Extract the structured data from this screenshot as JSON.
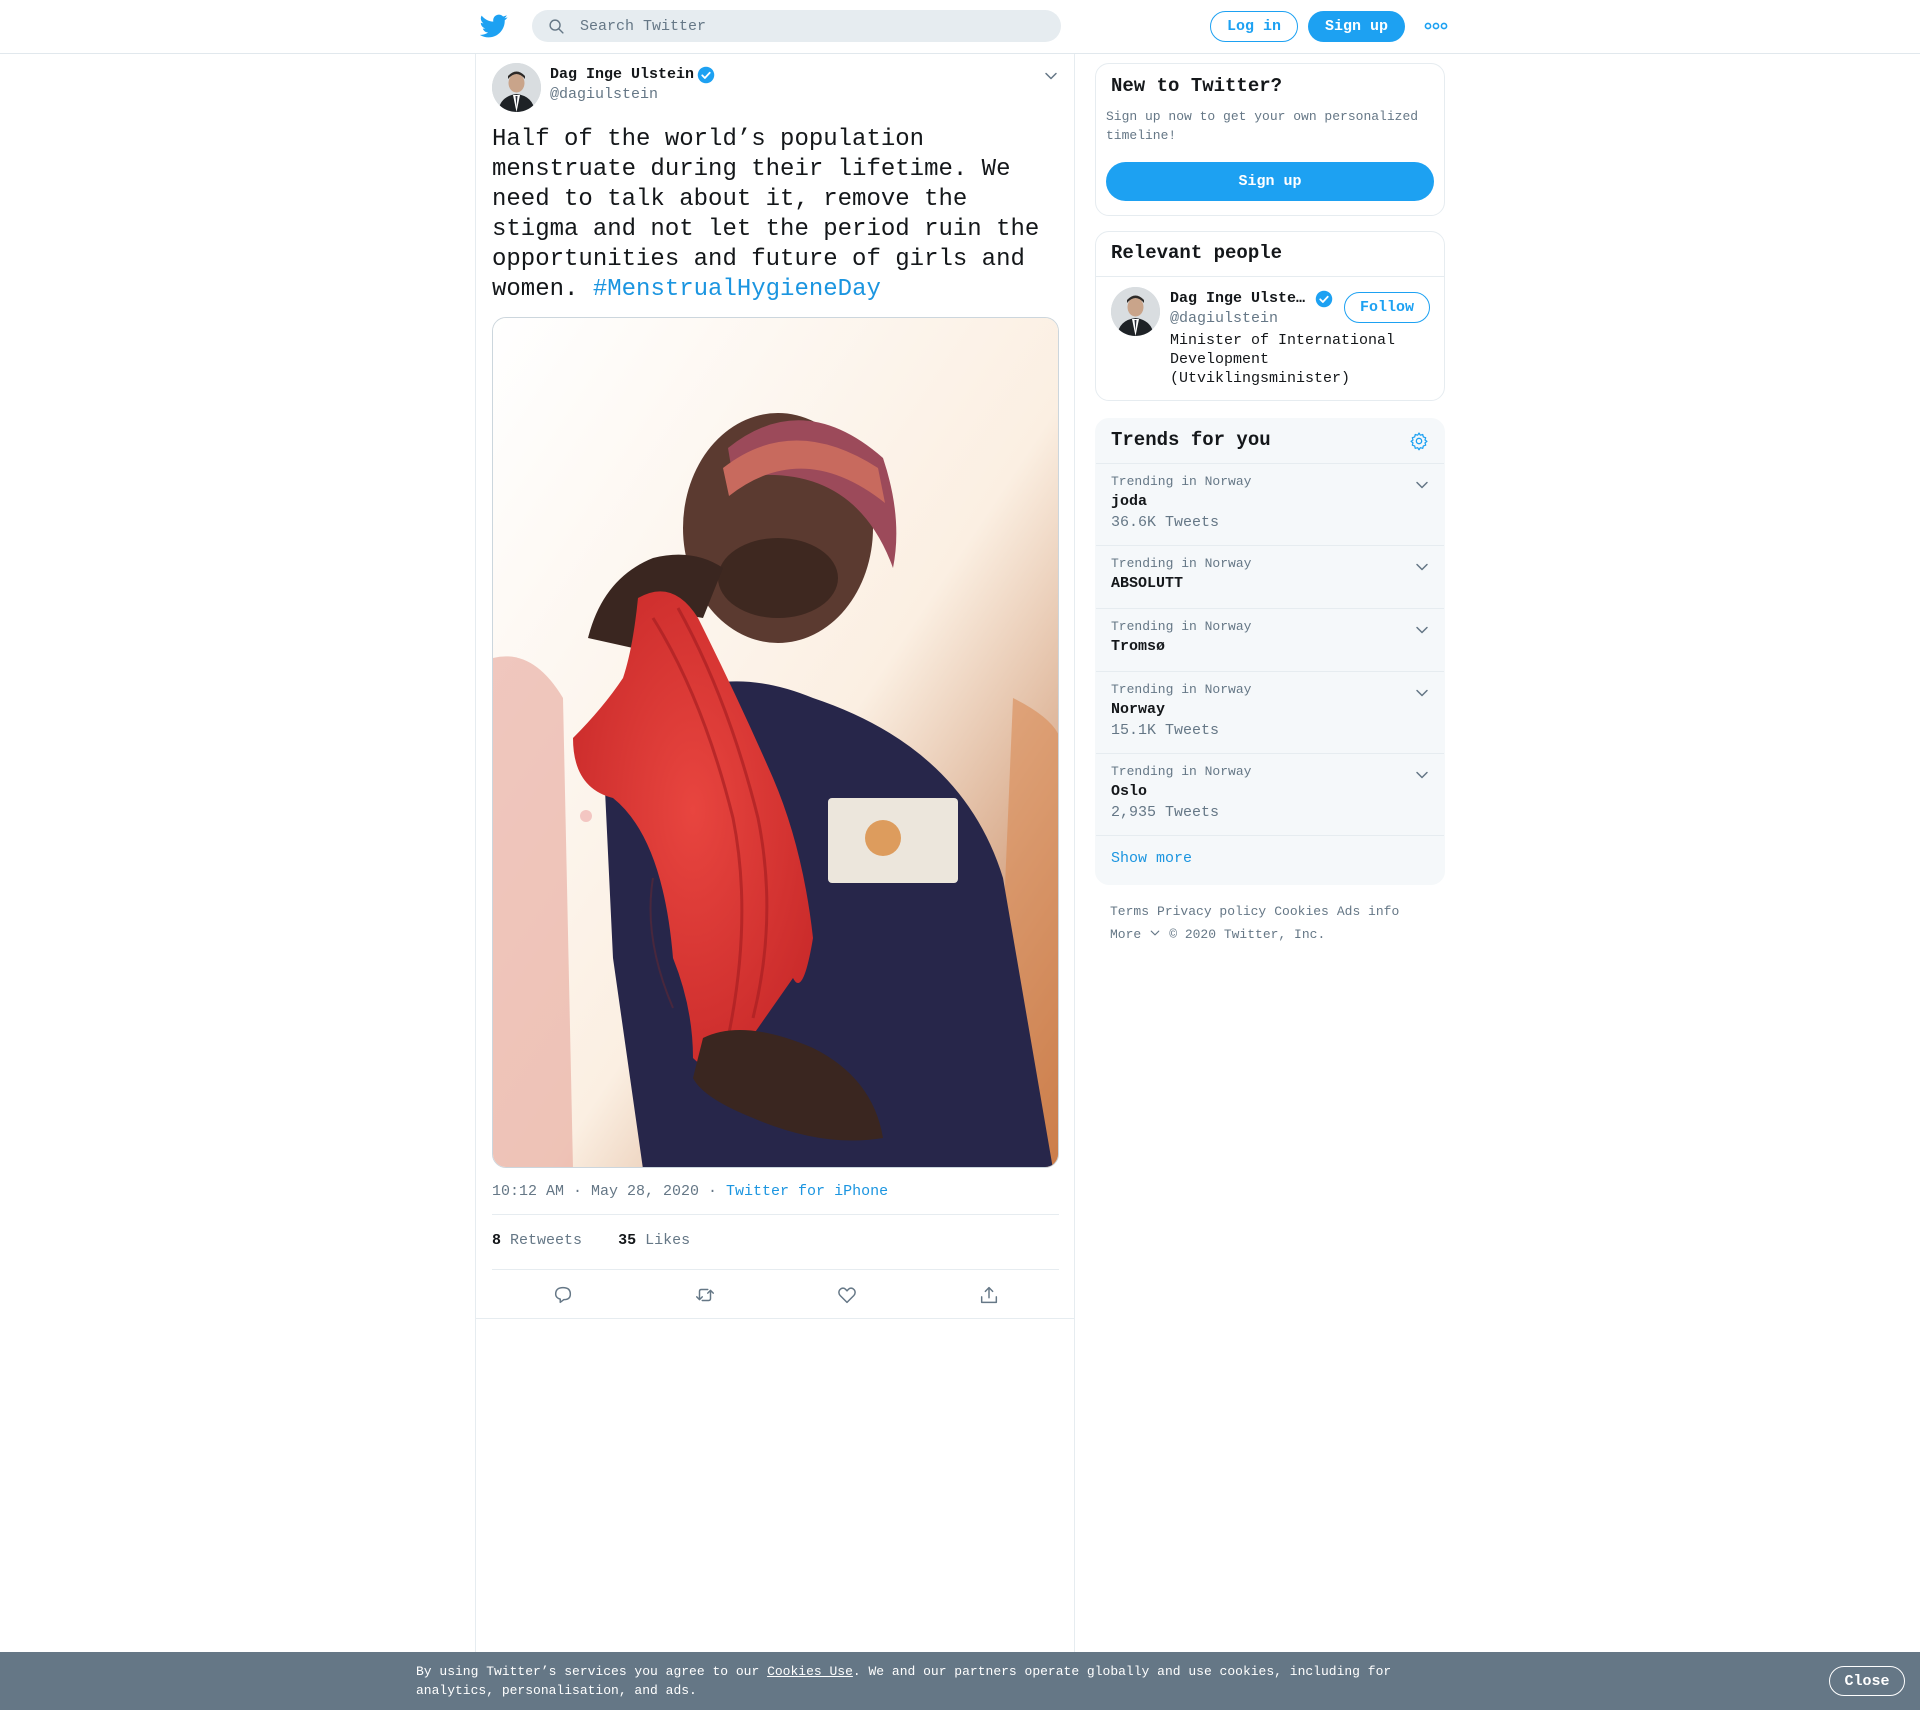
{
  "header": {
    "search_placeholder": "Search Twitter",
    "login_label": "Log in",
    "signup_label": "Sign up"
  },
  "tweet": {
    "author_name": "Dag Inge Ulstein",
    "author_handle": "@dagiulstein",
    "text": "Half of the world’s population menstruate during their lifetime. We need to talk about it, remove the stigma and not let the period ruin the opportunities and future of girls and women.",
    "hashtag": "#MenstrualHygieneDay",
    "time": "10:12 AM · May 28, 2020 · ",
    "source": "Twitter for iPhone",
    "retweets_count": "8",
    "retweets_label": "Retweets",
    "likes_count": "35",
    "likes_label": "Likes"
  },
  "sidebar": {
    "new_to_twitter": {
      "title": "New to Twitter?",
      "description": "Sign up now to get your own personalized timeline!",
      "signup_label": "Sign up"
    },
    "relevant_people": {
      "title": "Relevant people",
      "name": "Dag Inge Ulste…",
      "handle": "@dagiulstein",
      "follow_label": "Follow",
      "bio": "Minister of International Development (Utviklingsminister)"
    },
    "trends": {
      "title": "Trends for you",
      "items": [
        {
          "meta": "Trending in Norway",
          "name": "joda",
          "count": "36.6K Tweets"
        },
        {
          "meta": "Trending in Norway",
          "name": "ABSOLUTT",
          "count": ""
        },
        {
          "meta": "Trending in Norway",
          "name": "Tromsø",
          "count": ""
        },
        {
          "meta": "Trending in Norway",
          "name": "Norway",
          "count": "15.1K Tweets"
        },
        {
          "meta": "Trending in Norway",
          "name": "Oslo",
          "count": "2,935 Tweets"
        }
      ],
      "show_more": "Show more"
    },
    "footer": {
      "terms": "Terms",
      "privacy": "Privacy policy",
      "cookies": "Cookies",
      "ads_info": "Ads info",
      "more": "More",
      "copyright": "© 2020 Twitter, Inc."
    }
  },
  "cookie_banner": {
    "text_before": "By using Twitter’s services you agree to our ",
    "link": "Cookies Use",
    "text_after": ". We and our partners operate globally and use cookies, including for analytics, personalisation, and ads.",
    "close_label": "Close"
  },
  "colors": {
    "brand_blue": "#1da1f2",
    "link_blue": "#1b95e0",
    "secondary_text": "#657786",
    "primary_text": "#14171a",
    "cookie_bar_bg": "#657786"
  }
}
